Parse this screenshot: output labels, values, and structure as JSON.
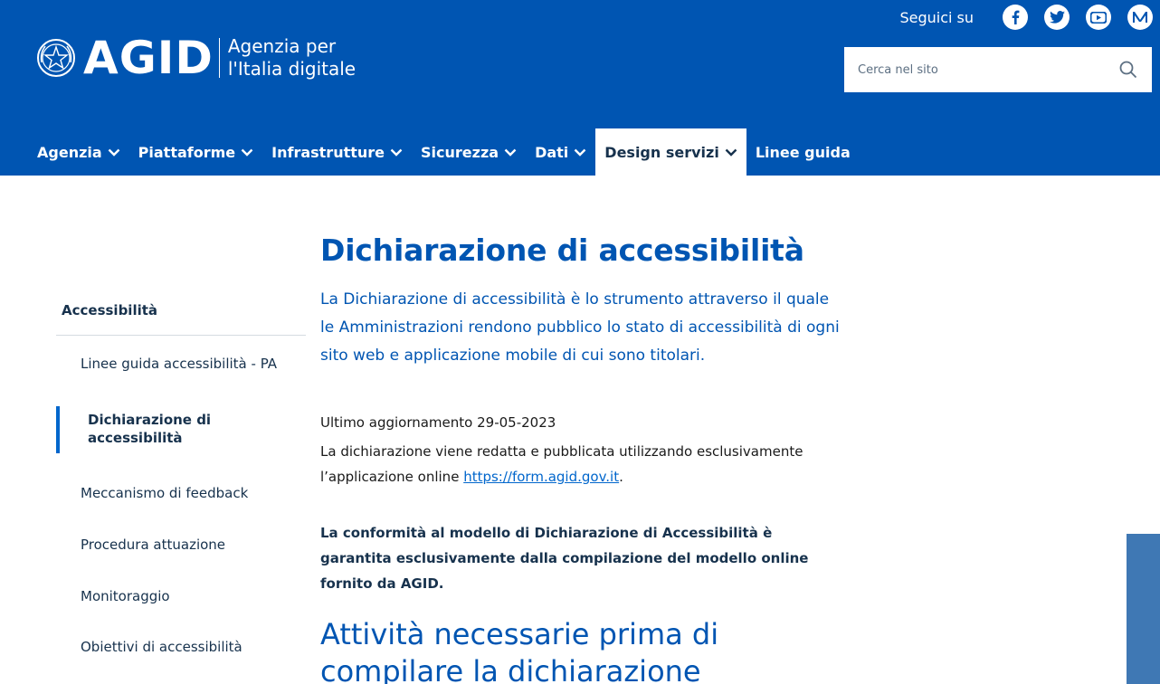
{
  "header": {
    "logo_text": "AGID",
    "agency_line1": "Agenzia per",
    "agency_line2": "l'Italia digitale",
    "social_label": "Seguici su",
    "social_icons": [
      "facebook-icon",
      "twitter-icon",
      "youtube-icon",
      "medium-icon"
    ],
    "search_placeholder": "Cerca nel sito"
  },
  "nav": {
    "items": [
      {
        "label": "Agenzia",
        "has_menu": true
      },
      {
        "label": "Piattaforme",
        "has_menu": true
      },
      {
        "label": "Infrastrutture",
        "has_menu": true
      },
      {
        "label": "Sicurezza",
        "has_menu": true
      },
      {
        "label": "Dati",
        "has_menu": true
      },
      {
        "label": "Design servizi",
        "has_menu": true,
        "active": true
      },
      {
        "label": "Linee guida",
        "has_menu": false
      }
    ]
  },
  "sidebar": {
    "title": "Accessibilità",
    "items": [
      {
        "label": "Linee guida accessibilità - PA"
      },
      {
        "label": "Dichiarazione di accessibilità",
        "active": true
      },
      {
        "label": "Meccanismo di feedback"
      },
      {
        "label": "Procedura attuazione"
      },
      {
        "label": "Monitoraggio"
      },
      {
        "label": "Obiettivi di accessibilità"
      }
    ]
  },
  "main": {
    "title": "Dichiarazione di accessibilità",
    "lead": "La Dichiarazione di accessibilità è lo strumento attraverso il quale le Amministrazioni rendono pubblico lo stato di accessibilità di ogni sito web e applicazione mobile di cui sono titolari.",
    "updated": "Ultimo aggiornamento 29-05-2023",
    "para_prefix": "La dichiarazione viene redatta e pubblicata utilizzando esclusivamente l’applicazione online ",
    "para_link": "https://form.agid.gov.it",
    "para_suffix": ".",
    "bold_para": "La conformità al modello di Dichiarazione di Accessibilità è garantita esclusivamente dalla compilazione del modello online fornito da AGID.",
    "section_title": "Attività necessarie prima di compilare la dichiarazione"
  },
  "colors": {
    "brand_blue": "#0055b2",
    "link_blue": "#0066cc",
    "dark_text": "#17324d"
  }
}
